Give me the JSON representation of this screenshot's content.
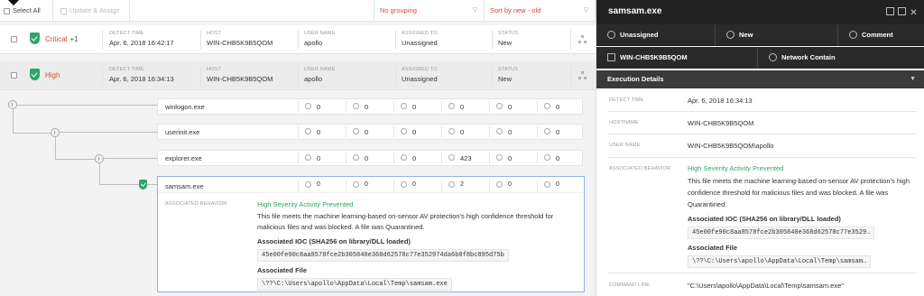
{
  "toolbar": {
    "select_all": "Select All",
    "update_assign": "Update & Assign",
    "grouping": "No grouping",
    "sorting": "Sort by new - old"
  },
  "labels": {
    "detect_time": "DETECT TIME",
    "host": "HOST",
    "user_name": "USER NAME",
    "assigned_to": "ASSIGNED TO",
    "status": "STATUS"
  },
  "detections": [
    {
      "severity": "Critical",
      "extra": "+1",
      "detect_time": "Apr. 6, 2018 16:42:17",
      "host": "WIN-CHB5K9B5QOM",
      "user": "apollo",
      "assigned": "Unassigned",
      "status": "New"
    },
    {
      "severity": "High",
      "extra": "",
      "detect_time": "Apr. 6, 2018 16:34:13",
      "host": "WIN-CHB5K9B5QOM",
      "user": "apollo",
      "assigned": "Unassigned",
      "status": "New"
    }
  ],
  "processes": [
    {
      "name": "winlogon.exe",
      "metrics": [
        "0",
        "0",
        "0",
        "0",
        "0",
        "0"
      ]
    },
    {
      "name": "userinit.exe",
      "metrics": [
        "0",
        "0",
        "0",
        "0",
        "0",
        "0"
      ]
    },
    {
      "name": "explorer.exe",
      "metrics": [
        "0",
        "0",
        "0",
        "423",
        "0",
        "0"
      ]
    },
    {
      "name": "samsam.exe",
      "metrics": [
        "0",
        "0",
        "0",
        "2",
        "0",
        "0"
      ]
    }
  ],
  "selected_process": {
    "associated_behavior_label": "ASSOCIATED BEHAVIOR",
    "behavior_title": "High Severity Activity Prevented",
    "description": "This file meets the machine learning-based on-sensor AV protection's high confidence threshold for malicious files and was blocked. A file was Quarantined.",
    "ioc_label": "Associated IOC (SHA256 on library/DLL loaded)",
    "ioc_value": "45e00fe90c8aa8578fce2b305840e368d62578c77e352974da6b8f8bc895d75b",
    "file_label": "Associated File",
    "file_value": "\\??\\C:\\Users\\apollo\\AppData\\Local\\Temp\\samsam.exe"
  },
  "detail_panel": {
    "title": "samsam.exe",
    "actions": {
      "unassigned": "Unassigned",
      "new": "New",
      "comment": "Comment",
      "host": "WIN-CHB5K9B5QOM",
      "network_contain": "Network Contain"
    },
    "section_title": "Execution Details",
    "fields": {
      "detect_time_label": "DETECT TIME",
      "detect_time": "Apr. 6, 2018 16:34:13",
      "hostname_label": "HOSTNAME",
      "hostname": "WIN-CHB5K9B5QOM",
      "user_name_label": "USER NAME",
      "user_name": "WIN-CHB5K9B5QOM\\apollo",
      "associated_behavior_label": "ASSOCIATED BEHAVIOR",
      "behavior_title": "High Severity Activity Prevented",
      "description": "This file meets the machine learning-based on-sensor AV protection's high confidence threshold for malicious files and was blocked. A file was Quarantined.",
      "ioc_label": "Associated IOC (SHA256 on library/DLL loaded)",
      "ioc_value": "45e00fe90c8aa8578fce2b305840e368d62578c77e3529…",
      "file_label": "Associated File",
      "file_value": "\\??\\C:\\Users\\apollo\\AppData\\Local\\Temp\\samsam…",
      "command_line_label": "COMMAND LINE",
      "command_line": "\"C:\\Users\\apollo\\AppData\\Local\\Temp\\samsam.exe\""
    }
  },
  "colors": {
    "severity_red": "#e0443f",
    "shield_green": "#2ea56a",
    "panel_dark": "#222222",
    "selection_blue": "#8fb4e6"
  }
}
